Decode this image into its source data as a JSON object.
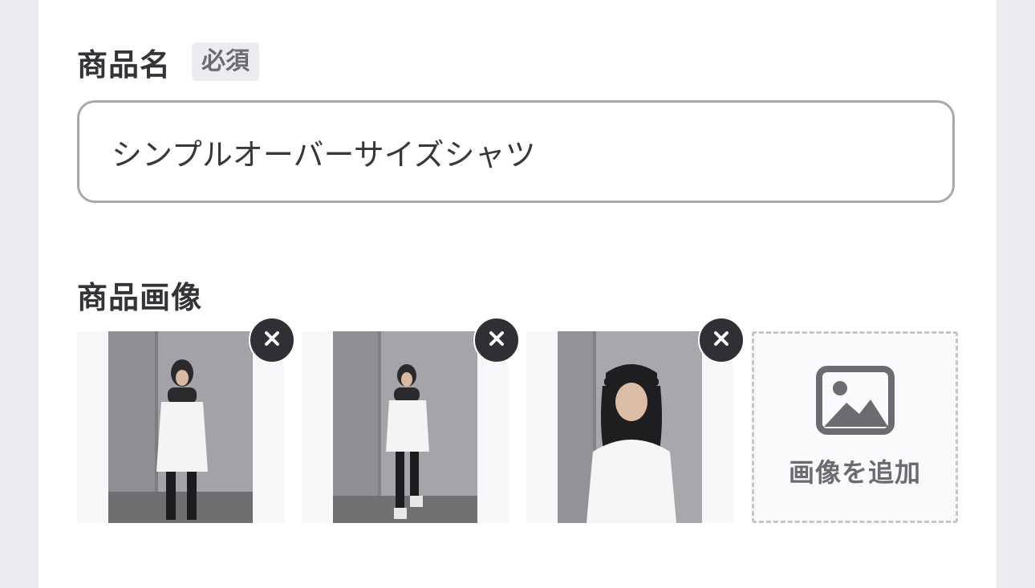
{
  "product_name": {
    "label": "商品名",
    "required_badge": "必須",
    "value": "シンプルオーバーサイズシャツ"
  },
  "product_images": {
    "label": "商品画像",
    "add_label": "画像を追加",
    "count": 3,
    "icons": {
      "remove": "close-icon",
      "add": "image-icon"
    }
  },
  "colors": {
    "text_dark": "#333338",
    "badge_bg": "#ececf0",
    "badge_text": "#6b6b72",
    "input_border": "#a8a8ad",
    "remove_button": "#2f2f34"
  }
}
